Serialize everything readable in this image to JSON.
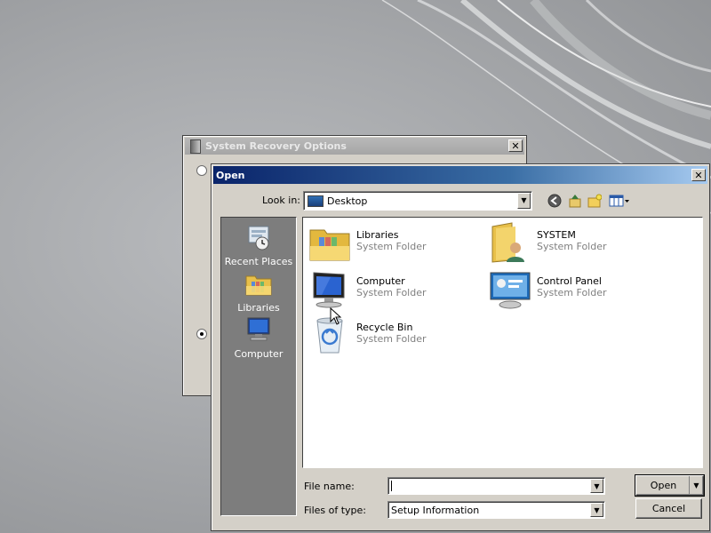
{
  "background": {
    "color": "#a9abae"
  },
  "recovery_dialog": {
    "title": "System Recovery Options",
    "close": "✕"
  },
  "open_dialog": {
    "title": "Open",
    "close": "✕",
    "look_in": {
      "label": "Look in:",
      "value": "Desktop"
    },
    "toolbar": [
      "back-icon",
      "up-folder-icon",
      "new-folder-icon",
      "view-menu-icon"
    ],
    "places": [
      {
        "label": "Recent Places",
        "icon": "recent-places-icon"
      },
      {
        "label": "Libraries",
        "icon": "libraries-icon"
      },
      {
        "label": "Computer",
        "icon": "computer-icon"
      }
    ],
    "items": [
      {
        "name": "Libraries",
        "type": "System Folder",
        "icon": "libraries-icon"
      },
      {
        "name": "SYSTEM",
        "type": "System Folder",
        "icon": "user-folder-icon"
      },
      {
        "name": "Computer",
        "type": "System Folder",
        "icon": "computer-icon"
      },
      {
        "name": "Control Panel",
        "type": "System Folder",
        "icon": "control-panel-icon"
      },
      {
        "name": "Recycle Bin",
        "type": "System Folder",
        "icon": "recycle-bin-icon"
      }
    ],
    "file_name": {
      "label": "File name:",
      "value": ""
    },
    "files_of_type": {
      "label": "Files of type:",
      "value": "Setup Information"
    },
    "buttons": {
      "open": "Open",
      "cancel": "Cancel"
    }
  },
  "colors": {
    "title_active": "#0a246a",
    "title_inactive": "#a6a6a6",
    "places_bg": "#7d7d7d"
  }
}
